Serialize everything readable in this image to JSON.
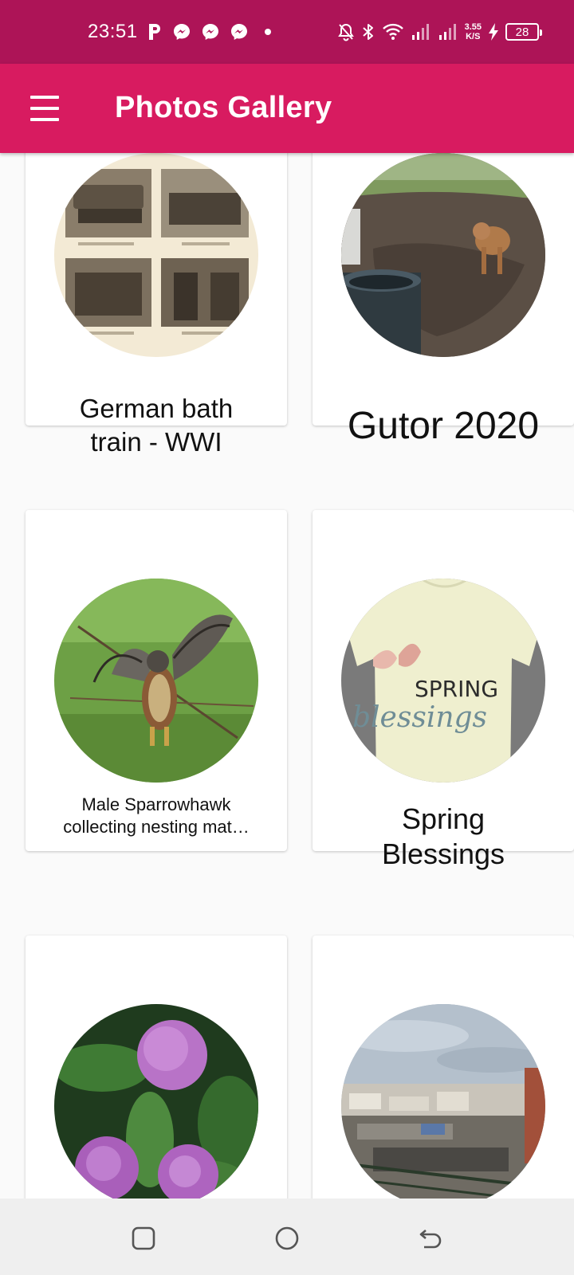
{
  "status_bar": {
    "time": "23:51",
    "net_speed_value": "3.55",
    "net_speed_unit": "K/S",
    "battery_level": "28"
  },
  "app_bar": {
    "title": "Photos Gallery"
  },
  "gallery": {
    "items": [
      {
        "caption": "German bath train - WWI"
      },
      {
        "caption": "Gutor 2020"
      },
      {
        "caption": "Male Sparrowhawk collecting nesting mat…"
      },
      {
        "caption": "Spring Blessings"
      },
      {
        "caption": ""
      },
      {
        "caption": ""
      }
    ]
  },
  "colors": {
    "status_bar": "#ad1457",
    "app_bar": "#d81b60",
    "nav_bar": "#efefef"
  }
}
